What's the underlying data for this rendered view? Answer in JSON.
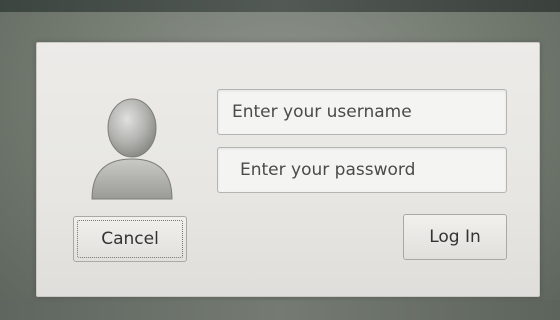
{
  "login_dialog": {
    "username_placeholder": "Enter your username",
    "password_placeholder": "Enter your password",
    "cancel_label": "Cancel",
    "login_label": "Log In",
    "avatar_icon": "user-silhouette-icon"
  },
  "colors": {
    "dialog_background": "#e7e6e2",
    "desktop_background": "#737a70",
    "field_background": "#f4f4f2",
    "text": "#4a4a4a"
  }
}
